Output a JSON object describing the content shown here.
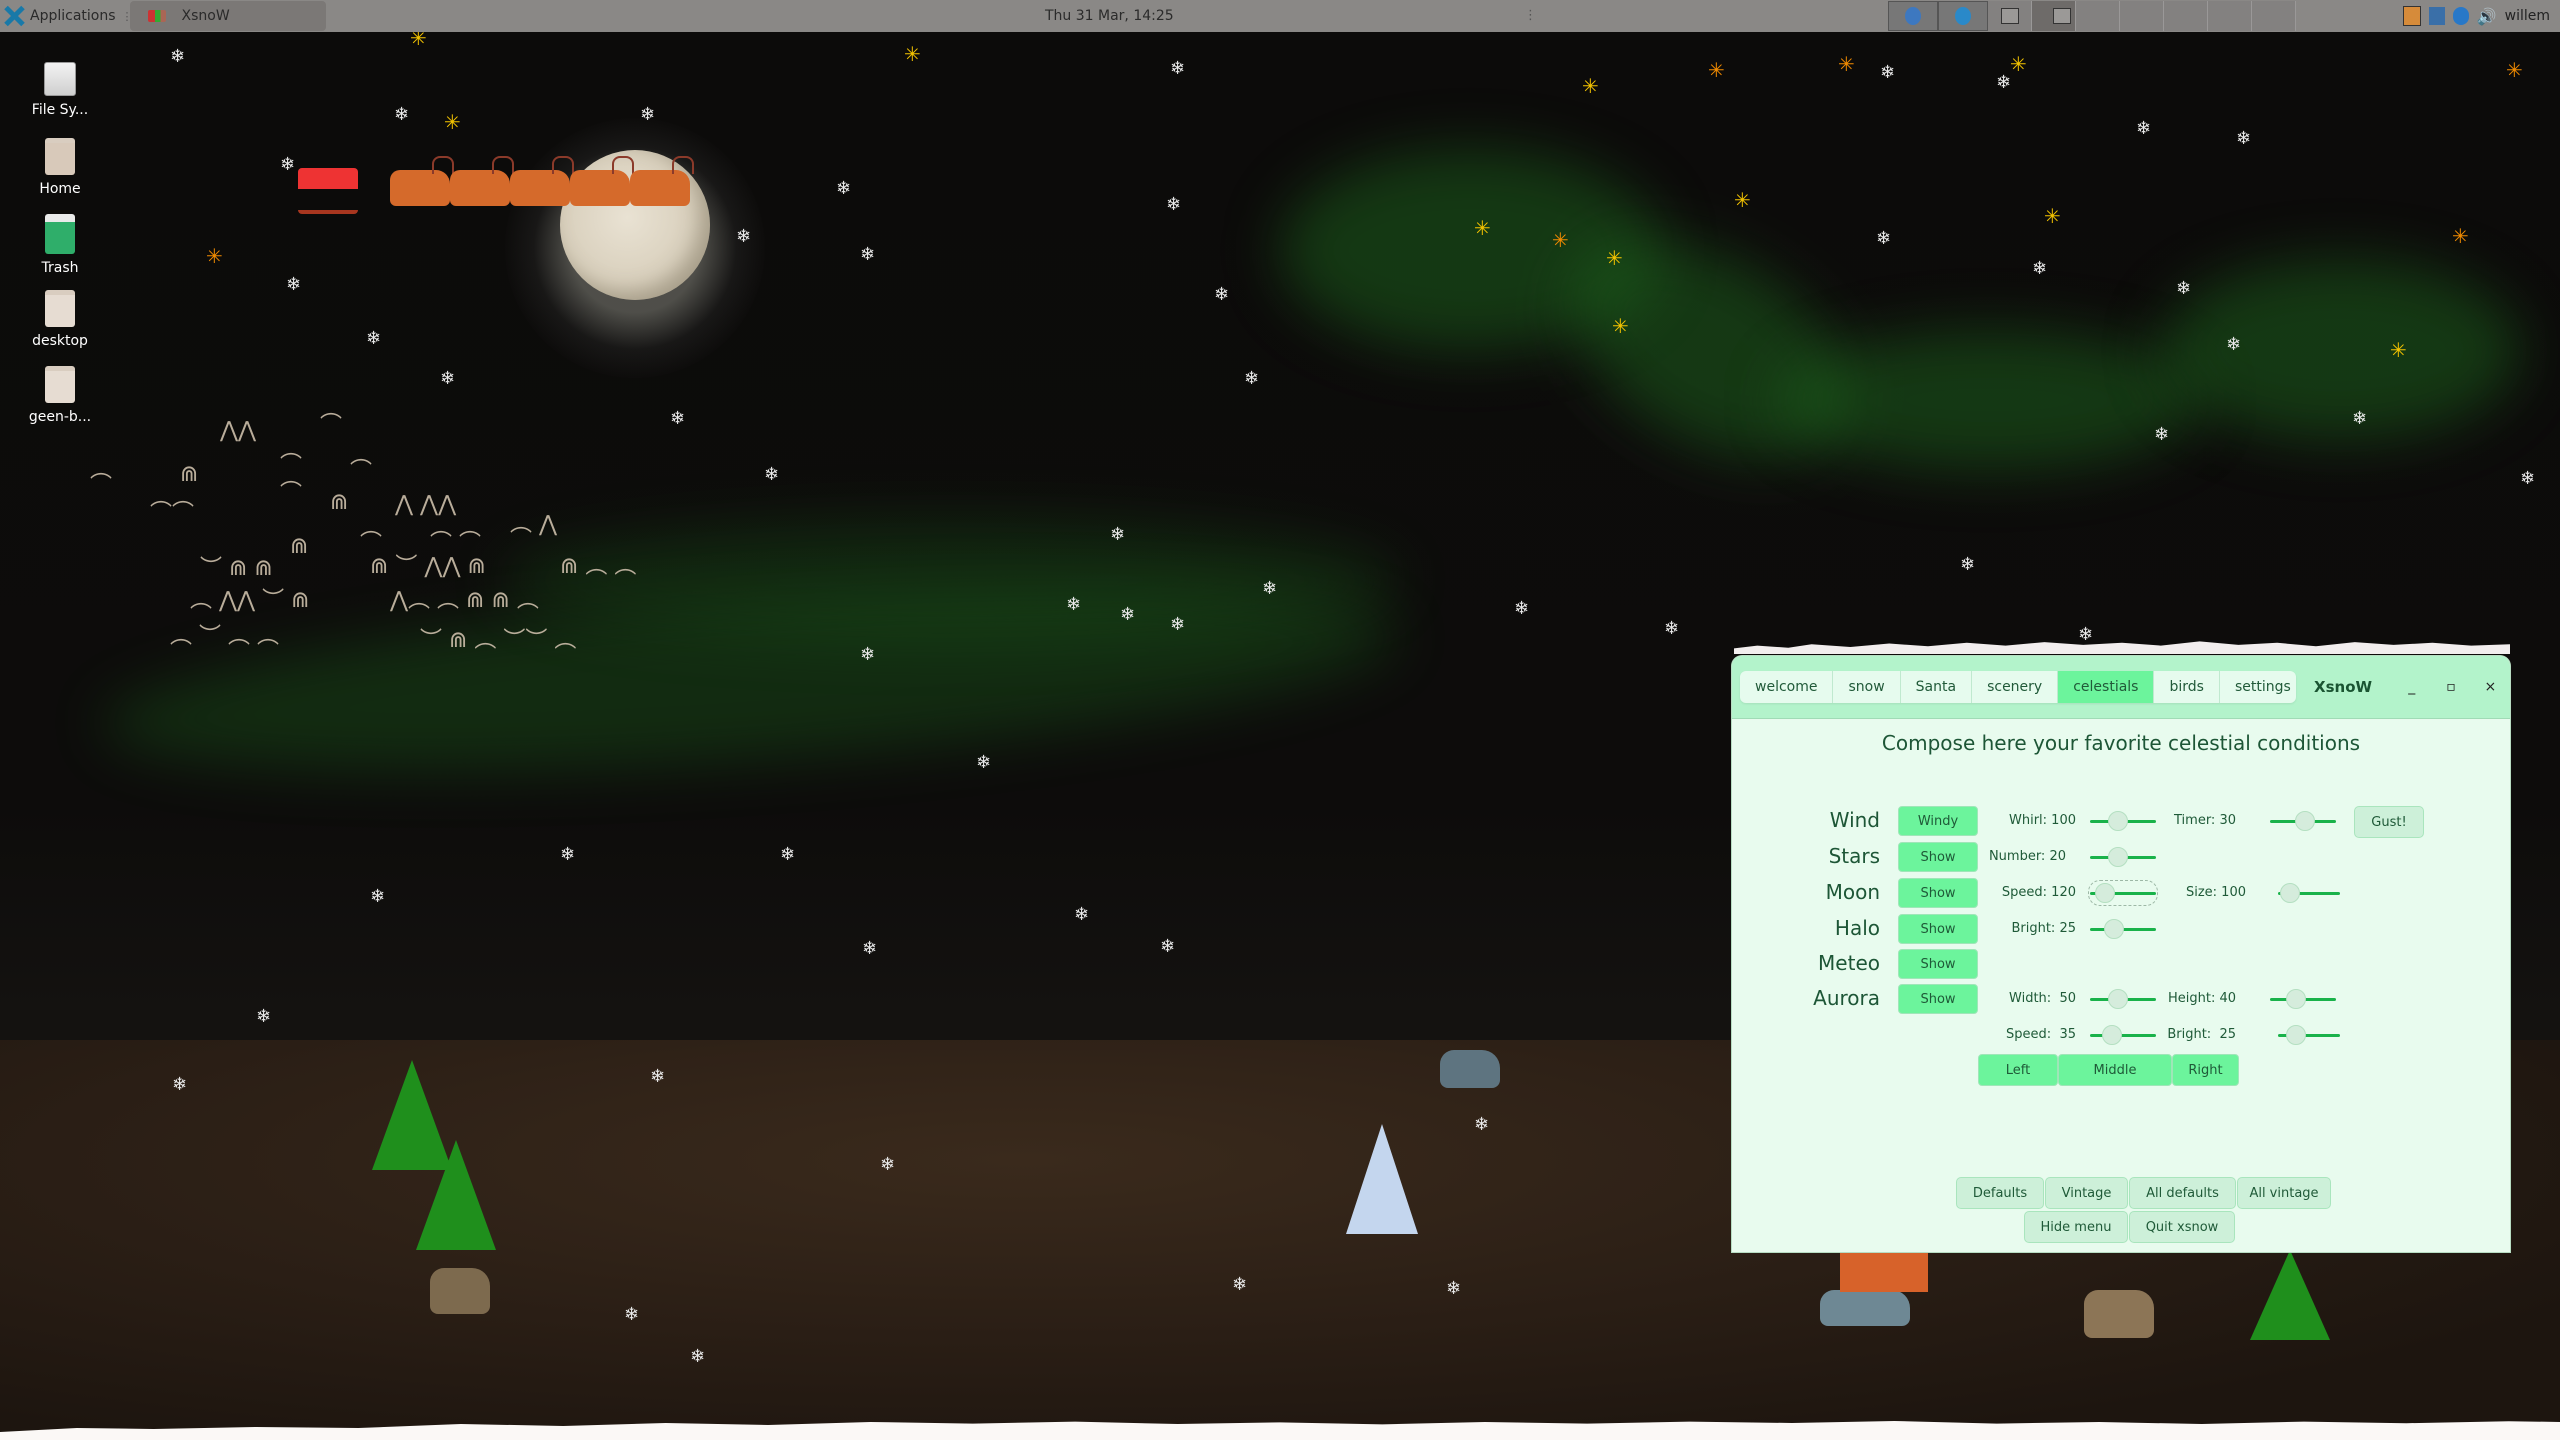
{
  "panel": {
    "applications_label": "Applications",
    "task_label": "XsnoW",
    "clock": "Thu 31 Mar, 14:25",
    "user": "willem",
    "workspace_icons": [
      "thunderbird-icon",
      "browser-icon"
    ],
    "tray_icons": [
      "clipboard-icon",
      "network-icon",
      "bluetooth-icon",
      "volume-icon"
    ]
  },
  "desktop": {
    "icons": [
      {
        "label": "File Sy...",
        "icon": "drive-icon"
      },
      {
        "label": "Home",
        "icon": "home-folder-icon"
      },
      {
        "label": "Trash",
        "icon": "trash-icon"
      },
      {
        "label": "desktop",
        "icon": "folder-icon"
      },
      {
        "label": "geen-b...",
        "icon": "folder-icon"
      }
    ]
  },
  "xsnow": {
    "title": "XsnoW",
    "tabs": [
      {
        "label": "welcome",
        "active": false
      },
      {
        "label": "snow",
        "active": false
      },
      {
        "label": "Santa",
        "active": false
      },
      {
        "label": "scenery",
        "active": false
      },
      {
        "label": "celestials",
        "active": true
      },
      {
        "label": "birds",
        "active": false
      },
      {
        "label": "settings",
        "active": false
      }
    ],
    "window_buttons": {
      "minimize": "_",
      "maximize": "▫",
      "close": "×"
    },
    "heading": "Compose here your favorite celestial conditions",
    "rows": {
      "wind": {
        "label": "Wind",
        "button": "Windy"
      },
      "stars": {
        "label": "Stars",
        "button": "Show"
      },
      "moon": {
        "label": "Moon",
        "button": "Show"
      },
      "halo": {
        "label": "Halo",
        "button": "Show"
      },
      "meteo": {
        "label": "Meteo",
        "button": "Show"
      },
      "aurora": {
        "label": "Aurora",
        "button": "Show"
      }
    },
    "sliders": {
      "whirl": {
        "label": "Whirl: 100",
        "value": 100,
        "fraction": 0.4
      },
      "timer": {
        "label": "Timer: 30",
        "value": 30,
        "fraction": 0.55
      },
      "number": {
        "label": "Number: 20",
        "value": 20,
        "fraction": 0.4
      },
      "moon_speed": {
        "label": "Speed: 120",
        "value": 120,
        "fraction": 0.1
      },
      "moon_size": {
        "label": "Size: 100",
        "value": 100,
        "fraction": 0.05
      },
      "halo_bright": {
        "label": "Bright: 25",
        "value": 25,
        "fraction": 0.3
      },
      "aurora_width": {
        "label": "Width:  50",
        "value": 50,
        "fraction": 0.4
      },
      "aurora_height": {
        "label": "Height: 40",
        "value": 40,
        "fraction": 0.35
      },
      "aurora_speed": {
        "label": "Speed:  35",
        "value": 35,
        "fraction": 0.25
      },
      "aurora_bright": {
        "label": "Bright:  25",
        "value": 25,
        "fraction": 0.2
      }
    },
    "gust_button": "Gust!",
    "aurora_position": [
      "Left",
      "Middle",
      "Right"
    ],
    "bottom_buttons": {
      "defaults": "Defaults",
      "vintage": "Vintage",
      "all_defaults": "All defaults",
      "all_vintage": "All vintage",
      "hide_menu": "Hide menu",
      "quit": "Quit xsnow"
    }
  },
  "colors": {
    "panel_bg": "#8a8886",
    "window_bg": "#e8fbee",
    "titlebar_bg": "#b3f3cb",
    "accent_green": "#6cf49c",
    "slider_track": "#19b24a",
    "text_green": "#1d5636",
    "star_yellow": "#f2c200",
    "aurora_green": "#1e6e1e"
  }
}
